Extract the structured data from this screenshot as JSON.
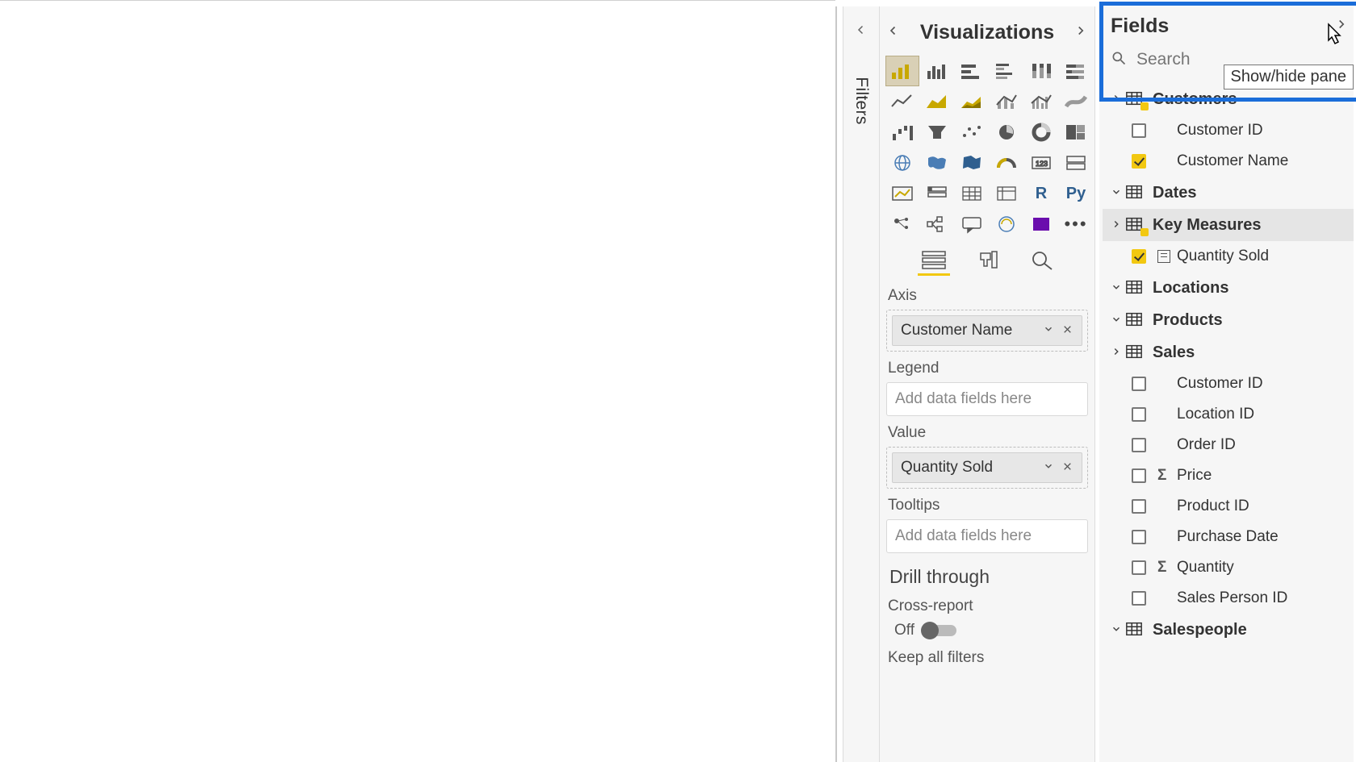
{
  "filters": {
    "label": "Filters"
  },
  "visualizations": {
    "title": "Visualizations",
    "icons": [
      "stacked-bar",
      "clustered-bar",
      "stacked-bar-h",
      "clustered-bar-h",
      "100-stacked-col",
      "100-stacked-bar",
      "line",
      "area",
      "stacked-area",
      "line-col",
      "line-col2",
      "ribbon",
      "waterfall",
      "funnel",
      "scatter",
      "pie",
      "donut",
      "treemap",
      "map",
      "filled-map",
      "shape-map",
      "gauge",
      "card",
      "multi-card",
      "kpi",
      "slicer",
      "table",
      "matrix",
      "r-visual",
      "python-visual",
      "key-influencers",
      "decomposition",
      "qna",
      "paginated",
      "powerapps",
      "more"
    ],
    "tabs": {
      "fields": "Fields tab",
      "format": "Format tab",
      "analytics": "Analytics tab"
    },
    "wells": {
      "axis": {
        "label": "Axis",
        "item": "Customer Name"
      },
      "legend": {
        "label": "Legend",
        "placeholder": "Add data fields here"
      },
      "value": {
        "label": "Value",
        "item": "Quantity Sold"
      },
      "tooltips": {
        "label": "Tooltips",
        "placeholder": "Add data fields here"
      }
    },
    "drill": {
      "title": "Drill through",
      "cross_report": "Cross-report",
      "off": "Off",
      "keep_all": "Keep all filters"
    }
  },
  "fields": {
    "title": "Fields",
    "search_placeholder": "Search",
    "tooltip": "Show/hide pane",
    "tables": [
      {
        "name": "Customers",
        "expanded": true,
        "badge": true,
        "fields": [
          {
            "name": "Customer ID",
            "checked": false
          },
          {
            "name": "Customer Name",
            "checked": true
          }
        ]
      },
      {
        "name": "Dates",
        "expanded": false
      },
      {
        "name": "Key Measures",
        "expanded": true,
        "badge": true,
        "selected": true,
        "fields": [
          {
            "name": "Quantity Sold",
            "checked": true,
            "measure": true
          }
        ]
      },
      {
        "name": "Locations",
        "expanded": false
      },
      {
        "name": "Products",
        "expanded": false
      },
      {
        "name": "Sales",
        "expanded": true,
        "fields": [
          {
            "name": "Customer ID",
            "checked": false
          },
          {
            "name": "Location ID",
            "checked": false
          },
          {
            "name": "Order ID",
            "checked": false
          },
          {
            "name": "Price",
            "checked": false,
            "sigma": true
          },
          {
            "name": "Product ID",
            "checked": false
          },
          {
            "name": "Purchase Date",
            "checked": false
          },
          {
            "name": "Quantity",
            "checked": false,
            "sigma": true
          },
          {
            "name": "Sales Person ID",
            "checked": false
          }
        ]
      },
      {
        "name": "Salespeople",
        "expanded": false
      }
    ]
  }
}
